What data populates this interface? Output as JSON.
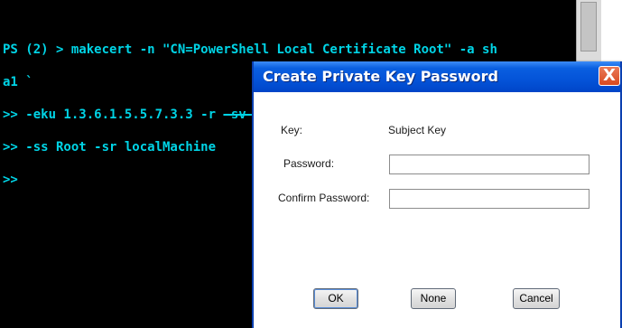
{
  "console": {
    "line1": "PS (2) > makecert -n \"CN=PowerShell Local Certificate Root\" -a sh",
    "line2": "a1 `",
    "line3_a": ">> -eku 1.3.6.1.5.5.7.3.3 -r ",
    "line3_b": "-sv root.pvk root.cer `",
    "line4": ">> -ss Root -sr localMachine",
    "line5": ">>"
  },
  "dialog": {
    "title": "Create Private Key Password",
    "close_glyph": "X",
    "key_label": "Key:",
    "key_value": "Subject Key",
    "password_label": "Password:",
    "password_value": "",
    "confirm_label": "Confirm Password:",
    "confirm_value": "",
    "ok_label": "OK",
    "none_label": "None",
    "cancel_label": "Cancel"
  },
  "colors": {
    "console_background": "#000000",
    "console_text": "#00d4e6",
    "titlebar_blue": "#0453d8",
    "close_red": "#d8491f"
  }
}
